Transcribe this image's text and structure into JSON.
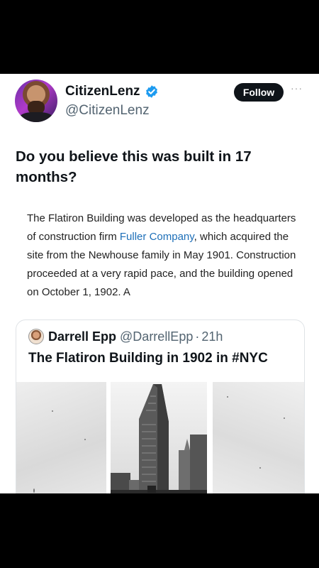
{
  "post": {
    "display_name": "CitizenLenz",
    "handle": "@CitizenLenz",
    "follow_label": "Follow",
    "more_label": "···",
    "headline": "Do you believe this was built in 17 months?",
    "body": {
      "part1": "The Flatiron Building was developed as the headquarters of construction firm ",
      "link": "Fuller Company",
      "part2": ", which acquired the site from the Newhouse family in May 1901. Construction proceeded at a very rapid pace, and the building opened on October 1, 1902. A"
    }
  },
  "quote": {
    "name": "Darrell Epp",
    "handle": "@DarrellEpp",
    "separator": "·",
    "time": "21h",
    "title": "The Flatiron Building in 1902 in #NYC"
  },
  "colors": {
    "verified_badge": "#1d9bf0",
    "link": "#1d6fb8",
    "follow_bg": "#0f1419"
  },
  "icons": [
    "verified-badge-icon",
    "more-options-icon"
  ]
}
